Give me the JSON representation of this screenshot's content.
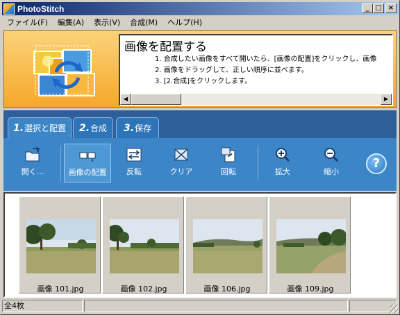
{
  "window": {
    "title": "PhotoStitch",
    "buttons": {
      "minimize": "_",
      "maximize": "□",
      "close": "×"
    }
  },
  "menu": [
    "ファイル(F)",
    "編集(A)",
    "表示(V)",
    "合成(M)",
    "ヘルプ(H)"
  ],
  "instructions": {
    "title": "画像を配置する",
    "lines": [
      "1. 合成したい画像をすべて開いたら、[画像の配置]をクリックし、画像",
      "2. 画像をドラッグして、正しい順序に並べます。",
      "3. [2.合成]をクリックします。"
    ],
    "scroll_left": "◀",
    "scroll_right": "▶"
  },
  "tabs": [
    {
      "num": "1.",
      "label": "選択と配置",
      "active": true
    },
    {
      "num": "2.",
      "label": "合成",
      "active": false
    },
    {
      "num": "3.",
      "label": "保存",
      "active": false
    }
  ],
  "toolbar": [
    {
      "label": "開く...",
      "icon": "open-folder-icon",
      "pressed": false
    },
    {
      "label": "画像の配置",
      "icon": "arrange-images-icon",
      "pressed": true
    },
    {
      "label": "反転",
      "icon": "flip-icon",
      "pressed": false
    },
    {
      "label": "クリア",
      "icon": "clear-icon",
      "pressed": false
    },
    {
      "label": "回転",
      "icon": "rotate-icon",
      "pressed": false
    },
    {
      "label": "拡大",
      "icon": "zoom-in-icon",
      "pressed": false
    },
    {
      "label": "縮小",
      "icon": "zoom-out-icon",
      "pressed": false
    }
  ],
  "help_label": "?",
  "thumbnails": [
    {
      "filename": "画像 101.jpg"
    },
    {
      "filename": "画像 102.jpg"
    },
    {
      "filename": "画像 106.jpg"
    },
    {
      "filename": "画像 109.jpg"
    }
  ],
  "status": {
    "count": "全4枚",
    "pane2": "",
    "pane3": ""
  },
  "colors": {
    "titlebar": "#0a246a",
    "banner": "#f6a82a",
    "tab_bar": "#2e5f9a",
    "toolbar": "#3c86c8"
  }
}
